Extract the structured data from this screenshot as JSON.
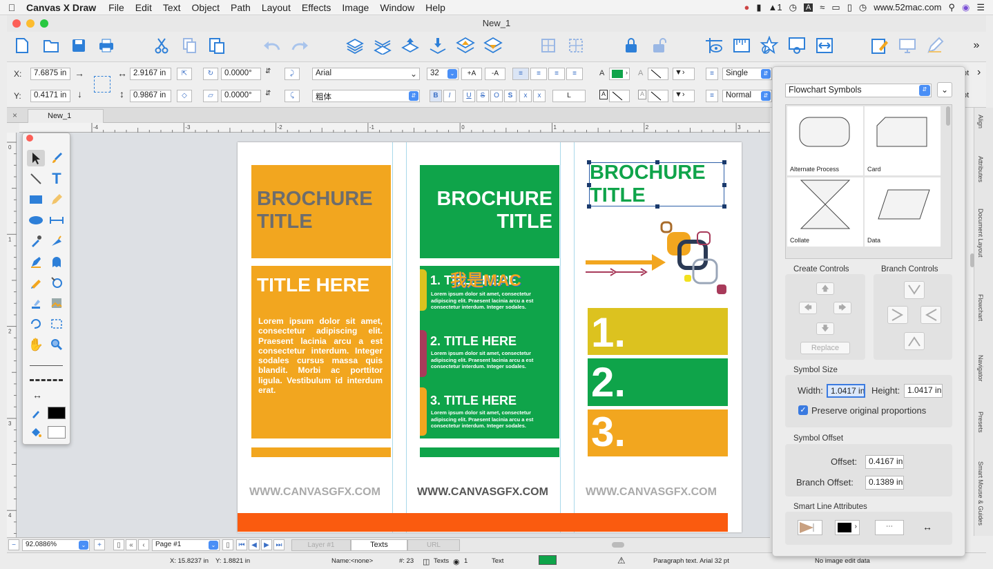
{
  "menubar": {
    "app_name": "Canvas X Draw",
    "items": [
      "File",
      "Edit",
      "Text",
      "Object",
      "Path",
      "Layout",
      "Effects",
      "Image",
      "Window",
      "Help"
    ],
    "status_number": "1",
    "site": "www.52mac.com"
  },
  "window": {
    "title": "New_1",
    "tab_label": "New_1"
  },
  "props": {
    "x_label": "X:",
    "x_value": "7.6875 in",
    "y_label": "Y:",
    "y_value": "0.4171 in",
    "w_value": "2.9167 in",
    "h_value": "0.9867 in",
    "rot1": "0.0000°",
    "rot2": "0.0000°",
    "font": "Arial",
    "font2": "粗体",
    "size": "32",
    "inc_font": "+A",
    "dec_font": "-A",
    "spacing": "Single",
    "spacing2": "Normal",
    "unit": "pt",
    "style_b": "B",
    "style_i": "I",
    "style_u": "U",
    "style_s": "S",
    "style_o": "O",
    "sup": "x",
    "sub": "x",
    "tab_char": "L",
    "fill_a": "A"
  },
  "brochure": {
    "col1_title": "BROCHURE\nTITLE",
    "col1_heading": "TITLE HERE",
    "col1_body": "Lorem ipsum dolor sit amet, consectetur adipiscing elit. Praesent lacinia arcu a est consectetur interdum. Integer sodales cursus massa quis blandit. Morbi ac porttitor ligula. Vestibulum id interdum erat.",
    "col2_title": "BROCHURE\nTITLE",
    "item1": "1. TITLE HERE",
    "item2": "2. TITLE HERE",
    "item3": "3. TITLE HERE",
    "item_body": "Lorem ipsum dolor sit amet, consectetur adipiscing elit. Praesent lacinia arcu a est consectetur interdum. Integer sodales.",
    "col3_title": "BROCHURE\nTITLE",
    "num1": "1.",
    "num2": "2.",
    "num3": "3.",
    "website": "WWW.CANVASGFX.COM",
    "watermark": "我是MAC"
  },
  "bottombar": {
    "zoom": "92.0886%",
    "page": "Page #1",
    "layer1": "Layer #1",
    "layer2": "Texts",
    "layer3": "URL"
  },
  "statusbar": {
    "x": "X: 15.8237 in",
    "y": "Y: 1.8821 in",
    "name": "Name:<none>",
    "count": "#: 23",
    "layer": "Texts",
    "num": "1",
    "kind": "Text",
    "info": "Paragraph text. Arial 32  pt",
    "edit": "No image edit data"
  },
  "panel": {
    "library": "Flowchart Symbols",
    "symbols": [
      "Alternate Process",
      "Card",
      "Collate",
      "Data"
    ],
    "create_controls": "Create Controls",
    "branch_controls": "Branch Controls",
    "replace": "Replace",
    "symbol_size": "Symbol Size",
    "width_label": "Width:",
    "width_value": "1.0417 in",
    "height_label": "Height:",
    "height_value": "1.0417 in",
    "preserve": "Preserve original proportions",
    "symbol_offset": "Symbol Offset",
    "offset_label": "Offset:",
    "offset_value": "0.4167 in",
    "branch_offset_label": "Branch Offset:",
    "branch_offset_value": "0.1389 in",
    "smart_line": "Smart Line Attributes"
  },
  "sidetabs": [
    "Align",
    "Attributes",
    "Document Layout",
    "Flowchart",
    "Navigator",
    "Presets",
    "Smart Mouse & Guides"
  ],
  "ruler_h": [
    "-4",
    "-3",
    "-2",
    "-1",
    "0",
    "1",
    "2",
    "3",
    "4",
    "5",
    "6",
    "7",
    "8",
    "9",
    "10"
  ],
  "ruler_v": [
    "0",
    "1",
    "2",
    "3",
    "4"
  ],
  "colors": {
    "orange": "#f2a61f",
    "green": "#0fa44a",
    "yellow": "#dcc21f",
    "red_orange": "#fa5b0f",
    "gray_title": "#6d6d6d",
    "accent": "#3a7ae0"
  }
}
